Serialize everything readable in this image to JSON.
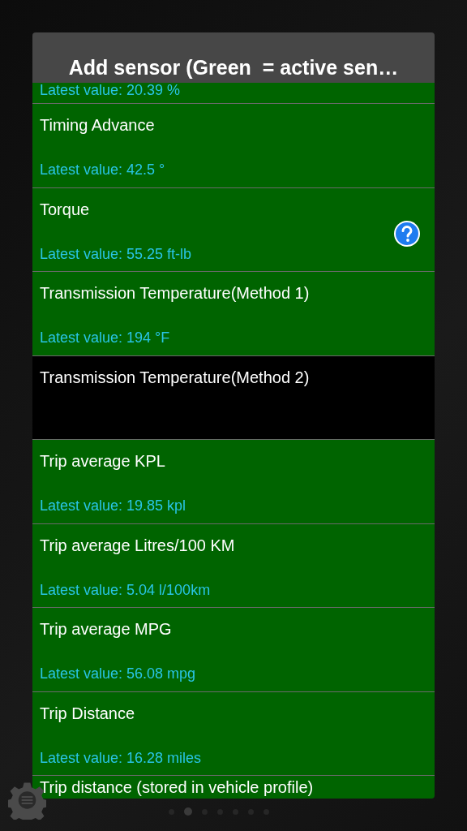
{
  "dialog": {
    "title": "Add sensor (Green  = active sen…"
  },
  "sensors": [
    {
      "active": true,
      "value": "Latest value: 20.39 %"
    },
    {
      "active": true,
      "name": "Timing Advance",
      "value": "Latest value: 42.5 °"
    },
    {
      "active": true,
      "name": "Torque",
      "value": "Latest value: 55.25 ft-lb",
      "help": true
    },
    {
      "active": true,
      "name": "Transmission Temperature(Method 1)",
      "value": "Latest value: 194 °F"
    },
    {
      "active": false,
      "name": "Transmission Temperature(Method 2)"
    },
    {
      "active": true,
      "name": "Trip average KPL",
      "value": "Latest value: 19.85 kpl"
    },
    {
      "active": true,
      "name": "Trip average Litres/100 KM",
      "value": "Latest value: 5.04 l/100km"
    },
    {
      "active": true,
      "name": "Trip average MPG",
      "value": "Latest value: 56.08 mpg"
    },
    {
      "active": true,
      "name": "Trip Distance",
      "value": "Latest value: 16.28 miles"
    },
    {
      "active": true,
      "name": "Trip distance (stored in vehicle profile)"
    }
  ],
  "page_dots": [
    {
      "selected": false
    },
    {
      "selected": true
    },
    {
      "selected": false
    },
    {
      "selected": false
    },
    {
      "selected": false
    },
    {
      "selected": false
    },
    {
      "selected": false
    }
  ]
}
